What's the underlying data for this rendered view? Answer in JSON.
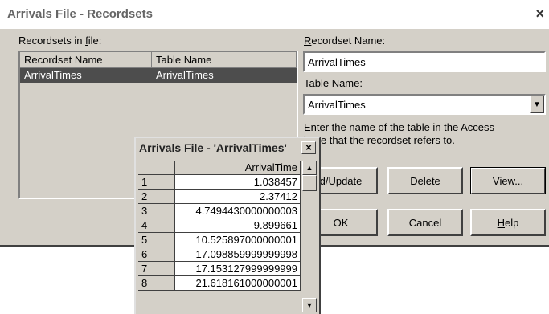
{
  "window": {
    "title": "Arrivals File - Recordsets",
    "close_glyph": "×"
  },
  "recordsets": {
    "label_pre": "Recordsets in ",
    "label_key": "f",
    "label_post": "ile:",
    "columns": [
      "Recordset Name",
      "Table Name"
    ],
    "rows": [
      {
        "recordset": "ArrivalTimes",
        "table": "ArrivalTimes"
      }
    ]
  },
  "recordset_name": {
    "label_key": "R",
    "label_rest": "ecordset Name:",
    "value": "ArrivalTimes"
  },
  "table_name": {
    "label_key": "T",
    "label_rest": "able Name:",
    "value": "ArrivalTimes",
    "dropdown_glyph": "▼"
  },
  "help_text": {
    "line1": "Enter the name of the table in the Access",
    "line2": "base that the recordset refers to."
  },
  "buttons": {
    "add_update": "d/Update",
    "delete_key": "D",
    "delete_rest": "elete",
    "view_key": "V",
    "view_rest": "iew...",
    "ok": "OK",
    "cancel": "Cancel",
    "help_key": "H",
    "help_rest": "elp"
  },
  "grid": {
    "title": "Arrivals File - 'ArrivalTimes'",
    "close_glyph": "×",
    "column": "ArrivalTime",
    "rows": [
      {
        "idx": "1",
        "value": "1.038457"
      },
      {
        "idx": "2",
        "value": "2.37412"
      },
      {
        "idx": "3",
        "value": "4.7494430000000003"
      },
      {
        "idx": "4",
        "value": "9.899661"
      },
      {
        "idx": "5",
        "value": "10.525897000000001"
      },
      {
        "idx": "6",
        "value": "17.098859999999998"
      },
      {
        "idx": "7",
        "value": "17.153127999999999"
      },
      {
        "idx": "8",
        "value": "21.618161000000001"
      }
    ],
    "scroll_up_glyph": "▲",
    "scroll_down_glyph": "▼"
  }
}
